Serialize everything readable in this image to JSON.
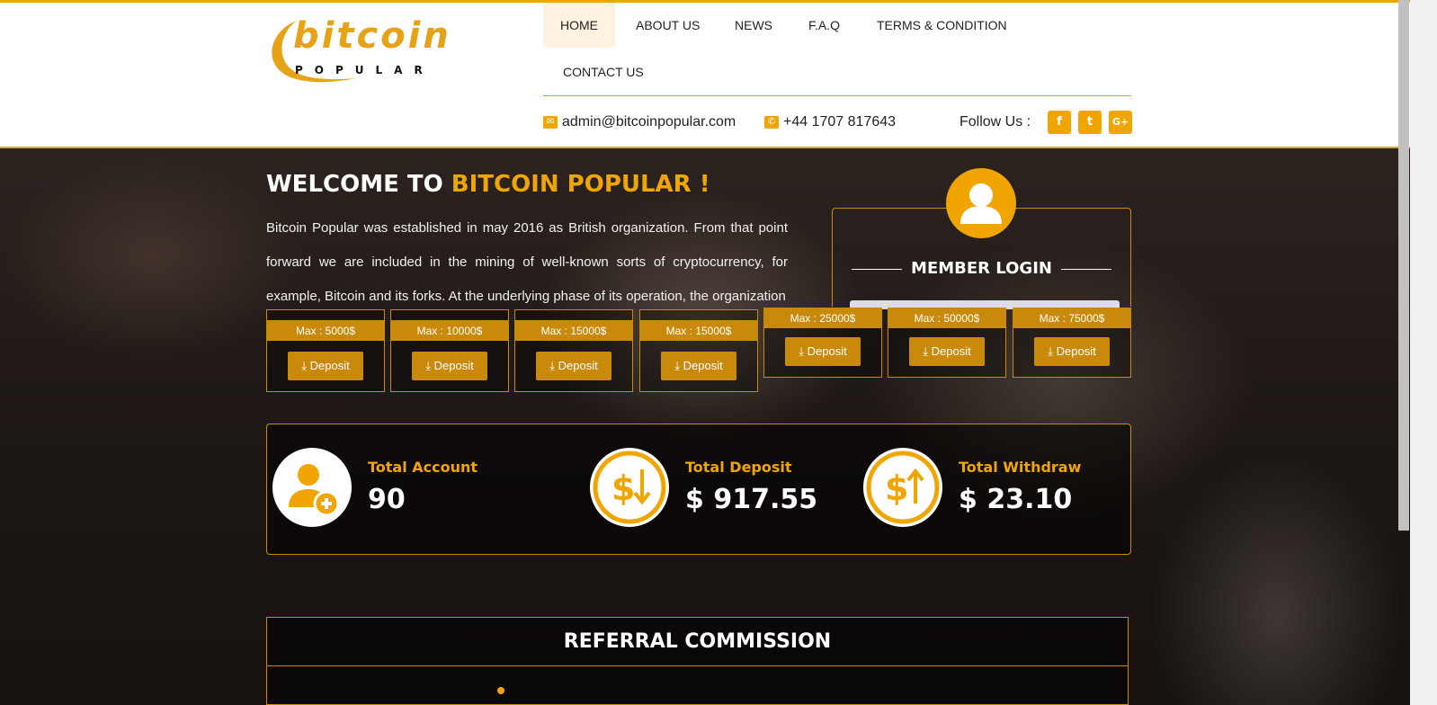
{
  "logo": {
    "word": "bitcoin",
    "sub": "POPULAR"
  },
  "nav": {
    "items": [
      {
        "label": "HOME"
      },
      {
        "label": "ABOUT US"
      },
      {
        "label": "NEWS"
      },
      {
        "label": "F.A.Q"
      },
      {
        "label": "TERMS & CONDITION"
      },
      {
        "label": "CONTACT US"
      }
    ],
    "active": "HOME"
  },
  "contact": {
    "email": "admin@bitcoinpopular.com",
    "phone": "+44 1707 817643",
    "follow_label": "Follow Us :",
    "socials": [
      "f",
      "t",
      "G+"
    ]
  },
  "hero": {
    "welcome_prefix": "WELCOME TO ",
    "welcome_highlight": "BITCOIN POPULAR !",
    "intro": "Bitcoin Popular was established in may 2016 as British organization. From that point forward we are included in the mining of well-known sorts of cryptocurrency, for example, Bitcoin and its forks. At the underlying phase of its operation, the organization"
  },
  "plans": [
    {
      "max": "Max : 5000$",
      "button": "Deposit"
    },
    {
      "max": "Max : 10000$",
      "button": "Deposit"
    },
    {
      "max": "Max : 15000$",
      "button": "Deposit"
    },
    {
      "max": "Max : 15000$",
      "button": "Deposit"
    },
    {
      "max": "Max : 25000$",
      "button": "Deposit"
    },
    {
      "max": "Max : 50000$",
      "button": "Deposit"
    },
    {
      "max": "Max : 75000$",
      "button": "Deposit"
    }
  ],
  "login": {
    "title": "MEMBER LOGIN"
  },
  "stats": [
    {
      "label": "Total Account",
      "value": "90"
    },
    {
      "label": "Total Deposit",
      "value": "$ 917.55"
    },
    {
      "label": "Total Withdraw",
      "value": "$ 23.10"
    }
  ],
  "referral": {
    "title": "REFERRAL COMMISSION"
  },
  "colors": {
    "accent": "#f0a500",
    "accent_dark": "#c98a0c"
  }
}
